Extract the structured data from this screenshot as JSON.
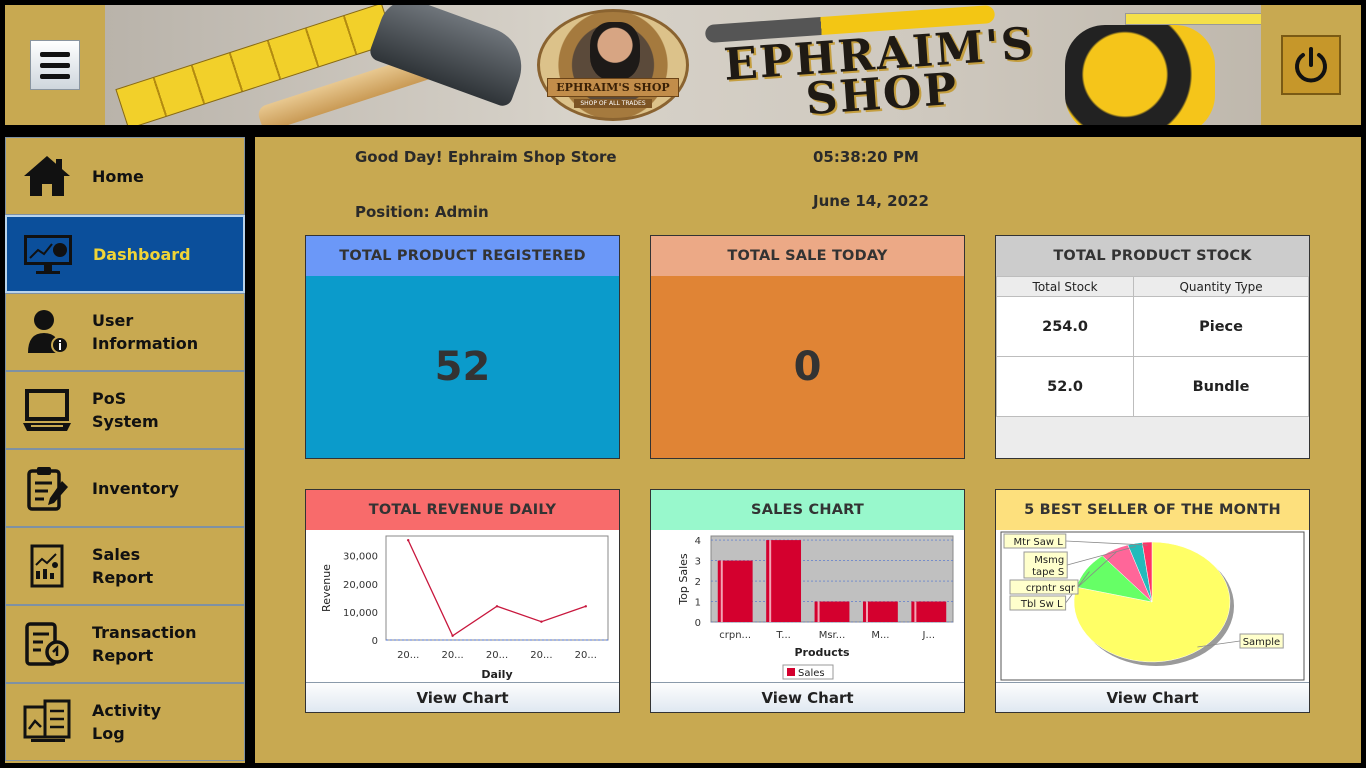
{
  "header": {
    "banner_title_line1": "EPHRAIM'S",
    "banner_title_line2": "SHOP",
    "logo_name": "EPHRAIM'S SHOP",
    "logo_tagline": "SHOP OF ALL TRADES"
  },
  "sidebar": {
    "items": [
      {
        "label_l1": "Home",
        "label_l2": "",
        "icon": "home-icon"
      },
      {
        "label_l1": "Dashboard",
        "label_l2": "",
        "icon": "dashboard-icon"
      },
      {
        "label_l1": "User",
        "label_l2": "Information",
        "icon": "user-info-icon"
      },
      {
        "label_l1": "PoS",
        "label_l2": "System",
        "icon": "laptop-icon"
      },
      {
        "label_l1": "Inventory",
        "label_l2": "",
        "icon": "clipboard-icon"
      },
      {
        "label_l1": "Sales",
        "label_l2": "Report",
        "icon": "report-icon"
      },
      {
        "label_l1": "Transaction",
        "label_l2": "Report",
        "icon": "transaction-icon"
      },
      {
        "label_l1": "Activity",
        "label_l2": "Log",
        "icon": "activity-log-icon"
      }
    ],
    "active": "Dashboard",
    "active_bg": "#0b4f9b",
    "active_text": "#f0d437"
  },
  "greeting": {
    "message": "Good Day! Ephraim Shop Store",
    "position": "Position: Admin",
    "time": "05:38:20 PM",
    "date": "June 14, 2022"
  },
  "cards": {
    "registered": {
      "title": "TOTAL PRODUCT REGISTERED",
      "value": "52",
      "head_color": "#6b98f8",
      "body_color": "#0b9bcb"
    },
    "sale_today": {
      "title": "TOTAL SALE TODAY",
      "value": "0",
      "head_color": "#eca986",
      "body_color": "#e08435"
    },
    "stock": {
      "title": "TOTAL PRODUCT STOCK",
      "head_color": "#cccccc",
      "columns": [
        "Total Stock",
        "Quantity Type"
      ],
      "rows": [
        [
          "254.0",
          "Piece"
        ],
        [
          "52.0",
          "Bundle"
        ]
      ]
    },
    "revenue": {
      "title": "TOTAL REVENUE DAILY",
      "head_color": "#f86b6b",
      "button": "View Chart"
    },
    "sales_chart": {
      "title": "SALES CHART",
      "head_color": "#98f8cc",
      "button": "View Chart"
    },
    "best_seller": {
      "title": "5 BEST SELLER OF THE MONTH",
      "head_color": "#fde07d",
      "button": "View Chart"
    }
  },
  "chart_data": [
    {
      "type": "line",
      "title": "",
      "xlabel": "Daily",
      "ylabel": "Revenue",
      "categories": [
        "20...",
        "20...",
        "20...",
        "20...",
        "20..."
      ],
      "x_positions": [
        0,
        1,
        2,
        3,
        4,
        5
      ],
      "values": [
        35500,
        1500,
        12000,
        6500,
        12000
      ],
      "yticks": [
        "0",
        "10,000",
        "20,000",
        "30,000"
      ],
      "ylim": [
        0,
        37000
      ],
      "color": "#c8173d"
    },
    {
      "type": "bar",
      "title": "",
      "xlabel": "Products",
      "ylabel": "Top Sales",
      "categories": [
        "crpn...",
        "T...",
        "Msr...",
        "M...",
        "J..."
      ],
      "series": [
        {
          "name": "Sales",
          "values": [
            3,
            4,
            1,
            1,
            1
          ]
        }
      ],
      "yticks": [
        "0",
        "1",
        "2",
        "3",
        "4"
      ],
      "ylim": [
        0,
        4.2
      ],
      "color": "#d4002e",
      "legend": "bottom"
    },
    {
      "type": "pie",
      "title": "",
      "labels": [
        "Sample",
        "Tbl Sw L",
        "crpntr sqr",
        "Msmg tape S",
        "Mtr Saw L"
      ],
      "label_lines": [
        [
          "Sample"
        ],
        [
          "Tbl Sw L"
        ],
        [
          "crpntr sqr"
        ],
        [
          "Msmg",
          "tape S"
        ],
        [
          "Mtr Saw L"
        ]
      ],
      "values": [
        79,
        10,
        6,
        3,
        2
      ],
      "colors": [
        "#ffff66",
        "#66ff66",
        "#ff6699",
        "#22bbbb",
        "#ff3366"
      ]
    }
  ]
}
